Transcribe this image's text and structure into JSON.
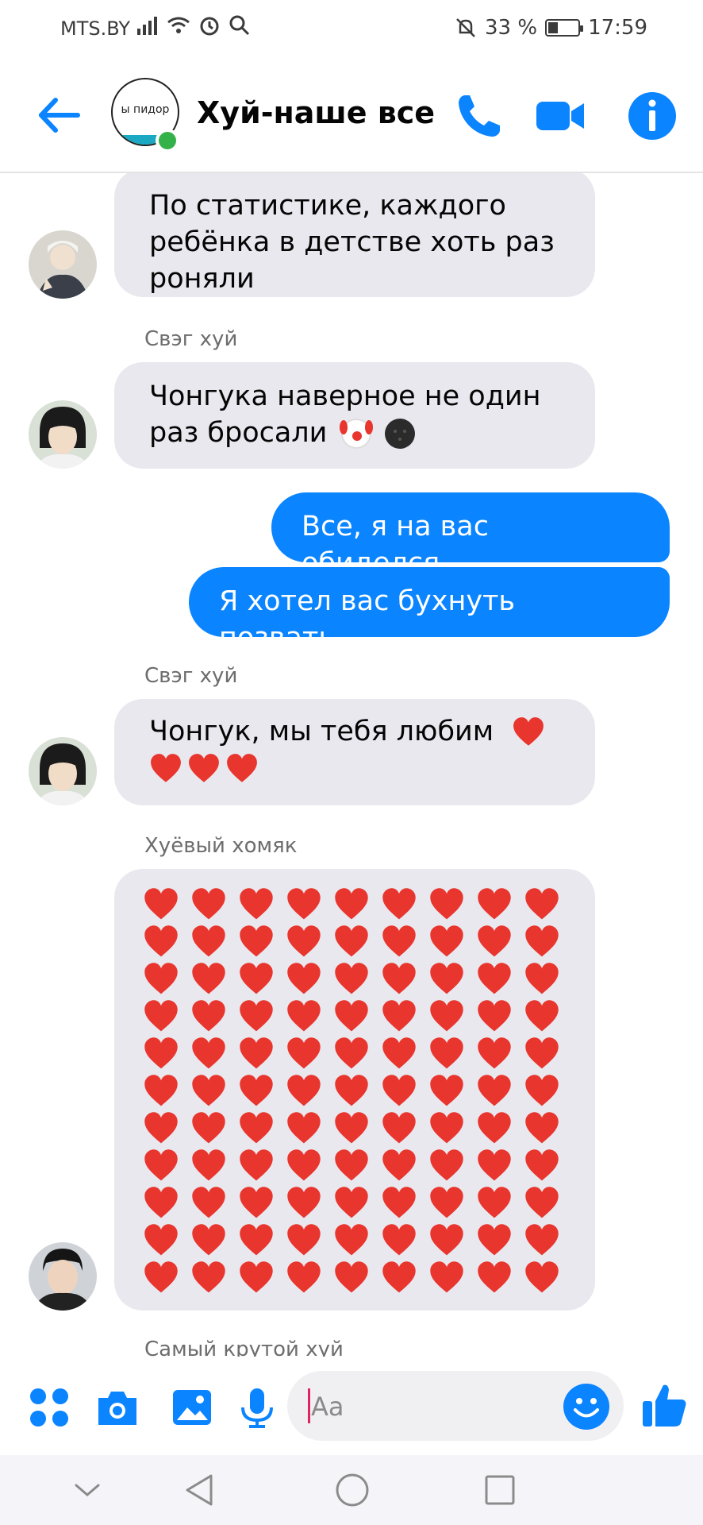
{
  "status_bar": {
    "carrier": "MTS.BY",
    "battery": "33 %",
    "battery_level": 0.33,
    "time": "17:59"
  },
  "header": {
    "title": "Хуй-наше все",
    "avatar_caption": "ы пидор",
    "icons": [
      "back-arrow-icon",
      "phone-icon",
      "video-camera-icon",
      "info-icon"
    ]
  },
  "messages": [
    {
      "id": "m1",
      "from": "other",
      "sender": "",
      "text": "По статистике, каждого ребёнка в детстве хоть раз роняли"
    },
    {
      "id": "m2",
      "from": "other",
      "sender": "Свэг хуй",
      "text": "Чонгука наверное не один раз бросали",
      "emojis": [
        "clown",
        "new-moon"
      ]
    },
    {
      "id": "m3",
      "from": "me",
      "text": "Все, я на вас обиделся"
    },
    {
      "id": "m4",
      "from": "me",
      "text": "Я хотел вас бухнуть позвать"
    },
    {
      "id": "m5",
      "from": "other",
      "sender": "Свэг хуй",
      "text": "Чонгук, мы тебя любим",
      "hearts": 4
    },
    {
      "id": "m6",
      "from": "other",
      "sender": "Хуёвый хомяк",
      "hearts": 99
    },
    {
      "id": "m7",
      "from": "other",
      "sender": "Самый крутой хуй"
    }
  ],
  "composer": {
    "placeholder": "Aa",
    "icons": [
      "apps-icon",
      "camera-icon",
      "gallery-icon",
      "microphone-icon",
      "emoji-icon",
      "thumbs-up-icon"
    ]
  },
  "colors": {
    "accent": "#0a84ff",
    "incoming_bubble": "#e9e8ee",
    "heart": "#e8352e",
    "online": "#35b14a"
  }
}
